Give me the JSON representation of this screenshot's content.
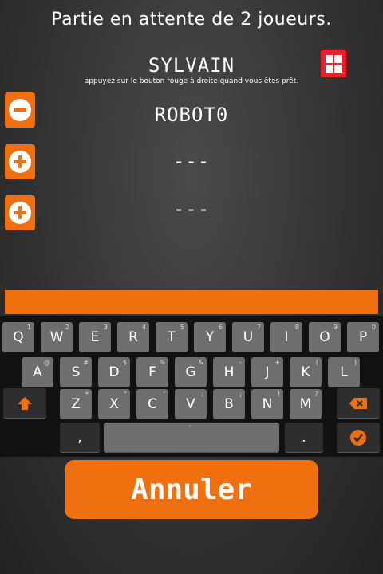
{
  "header": {
    "title": "Partie en attente de 2 joueurs."
  },
  "player": {
    "name": "SYLVAIN",
    "instructions": "appuyez sur le bouton rouge à droite quand vous êtes prêt."
  },
  "slots": [
    {
      "label": "ROBOT0",
      "button_icon": "minus-icon"
    },
    {
      "label": "---",
      "button_icon": "plus-icon"
    },
    {
      "label": "---",
      "button_icon": "plus-icon"
    }
  ],
  "keyboard": {
    "row1": [
      [
        "Q",
        "1"
      ],
      [
        "W",
        "2"
      ],
      [
        "E",
        "3"
      ],
      [
        "R",
        "4"
      ],
      [
        "T",
        "5"
      ],
      [
        "Y",
        "6"
      ],
      [
        "U",
        "7"
      ],
      [
        "I",
        "8"
      ],
      [
        "O",
        "9"
      ],
      [
        "P",
        "0"
      ]
    ],
    "row2": [
      [
        "A",
        "@"
      ],
      [
        "S",
        "#"
      ],
      [
        "D",
        "$"
      ],
      [
        "F",
        "%"
      ],
      [
        "G",
        "&"
      ],
      [
        "H",
        "-"
      ],
      [
        "J",
        "+"
      ],
      [
        "K",
        "("
      ],
      [
        "L",
        ")"
      ]
    ],
    "row3": [
      [
        "Z",
        "*"
      ],
      [
        "X",
        "\""
      ],
      [
        "C",
        "'"
      ],
      [
        "V",
        ":"
      ],
      [
        "B",
        ";"
      ],
      [
        "N",
        "!"
      ],
      [
        "M",
        "?"
      ]
    ],
    "row4": {
      "comma": ",",
      "space_alt": "'",
      "period": "."
    }
  },
  "actions": {
    "cancel": "Annuler"
  },
  "colors": {
    "accent": "#f07010",
    "ready": "#e8212a",
    "key": "#6e6e6e",
    "keyboard_bg": "#121212"
  }
}
